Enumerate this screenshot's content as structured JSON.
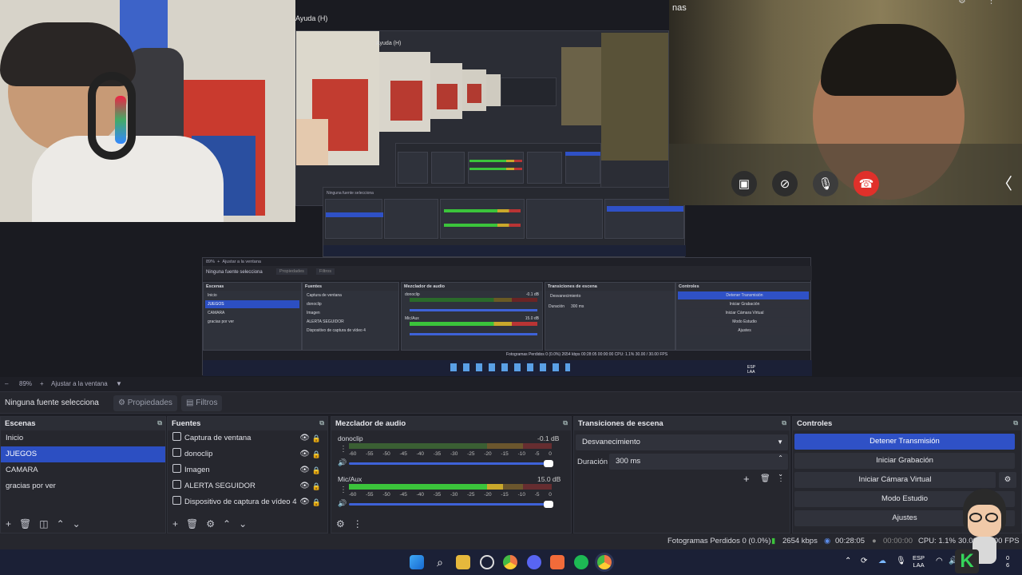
{
  "preview": {
    "left_cam_bg": "#d7d3c9",
    "right_cam_label": "nas",
    "menu_help": "Ayuda (H)",
    "menu_help_small": "Ayuda (H)",
    "call_icons": [
      "screen-off-icon",
      "camera-off-icon",
      "microphone-icon",
      "hang-up-icon"
    ],
    "call_chevron": "〈",
    "nested": {
      "zoom_pct": "89%",
      "zoom_label": "Ajustar a la ventana",
      "source_label": "Ninguna fuente selecciona",
      "props_label": "Propiedades",
      "filters_label": "Filtros",
      "scenes_title": "Escenas",
      "sources_title": "Fuentes",
      "mixer_title": "Mezclador de audio",
      "transitions_title": "Transiciones de escena",
      "controls_title": "Controles",
      "scenes": [
        "Inicio",
        "JUEGOS",
        "CAMARA",
        "gracias por ver"
      ],
      "sources": [
        "Captura de ventana",
        "donoclip",
        "Imagen",
        "ALERTA SEGUIDOR",
        "Dispositivo de captura de vídeo 4"
      ],
      "ch1": "donoclip",
      "ch1_db": "-0.1 dB",
      "ch2": "Mic/Aux",
      "ch2_db": "15.0 dB",
      "transition": "Desvanecimiento",
      "dur_label": "Duración",
      "dur_val": "300 ms",
      "controls": [
        "Detener Transmisión",
        "Iniciar Grabación",
        "Iniciar Cámara Virtual",
        "Modo Estudio",
        "Ajustes"
      ],
      "status": "Fotogramas Perdidos 0 (0.0%)   2654 kbps   00:28:05   00:00:00   CPU: 1.1%   30.00 / 30.00 FPS",
      "tray_lang": "ESP",
      "tray_region": "LAA"
    }
  },
  "zoombar": {
    "minus": "–",
    "zoom": "89%",
    "plus": "+",
    "fit": "Ajustar a la ventana"
  },
  "source_bar": {
    "label": "Ninguna fuente selecciona",
    "properties": "Propiedades",
    "filters": "Filtros"
  },
  "scenes": {
    "title": "Escenas",
    "items": [
      "Inicio",
      "JUEGOS",
      "CAMARA",
      "gracias por ver"
    ],
    "selected": "JUEGOS"
  },
  "sources": {
    "title": "Fuentes",
    "items": [
      {
        "label": "Captura de ventana",
        "icon": "window-capture-icon"
      },
      {
        "label": "donoclip",
        "icon": "browser-source-icon"
      },
      {
        "label": "Imagen",
        "icon": "image-icon"
      },
      {
        "label": "ALERTA SEGUIDOR",
        "icon": "browser-source-icon"
      },
      {
        "label": "Dispositivo de captura de vídeo 4",
        "icon": "camera-icon"
      }
    ]
  },
  "mixer": {
    "title": "Mezclador de audio",
    "scale": [
      "-60",
      "-55",
      "-50",
      "-45",
      "-40",
      "-35",
      "-30",
      "-25",
      "-20",
      "-15",
      "-10",
      "-5",
      "0"
    ],
    "channels": [
      {
        "name": "donoclip",
        "db": "-0.1 dB",
        "level": 0.0
      },
      {
        "name": "Mic/Aux",
        "db": "15.0 dB",
        "level": 0.8
      }
    ]
  },
  "transitions": {
    "title": "Transiciones de escena",
    "selected": "Desvanecimiento",
    "duration_label": "Duración",
    "duration_value": "300 ms"
  },
  "controls": {
    "title": "Controles",
    "buttons": [
      "Detener Transmisión",
      "Iniciar Grabación",
      "Iniciar Cámara Virtual",
      "Modo Estudio",
      "Ajustes"
    ],
    "accent": "#2f51c6"
  },
  "status": {
    "dropped": "Fotogramas Perdidos 0 (0.0%)",
    "bitrate": "2654 kbps",
    "stream_time": "00:28:05",
    "rec_time": "00:00:00",
    "cpu": "CPU: 1.1%",
    "fps": "30.00 / 30.00 FPS"
  },
  "taskbar": {
    "lang": "ESP",
    "region": "LAA",
    "clock_a": "0",
    "clock_b": "6"
  }
}
